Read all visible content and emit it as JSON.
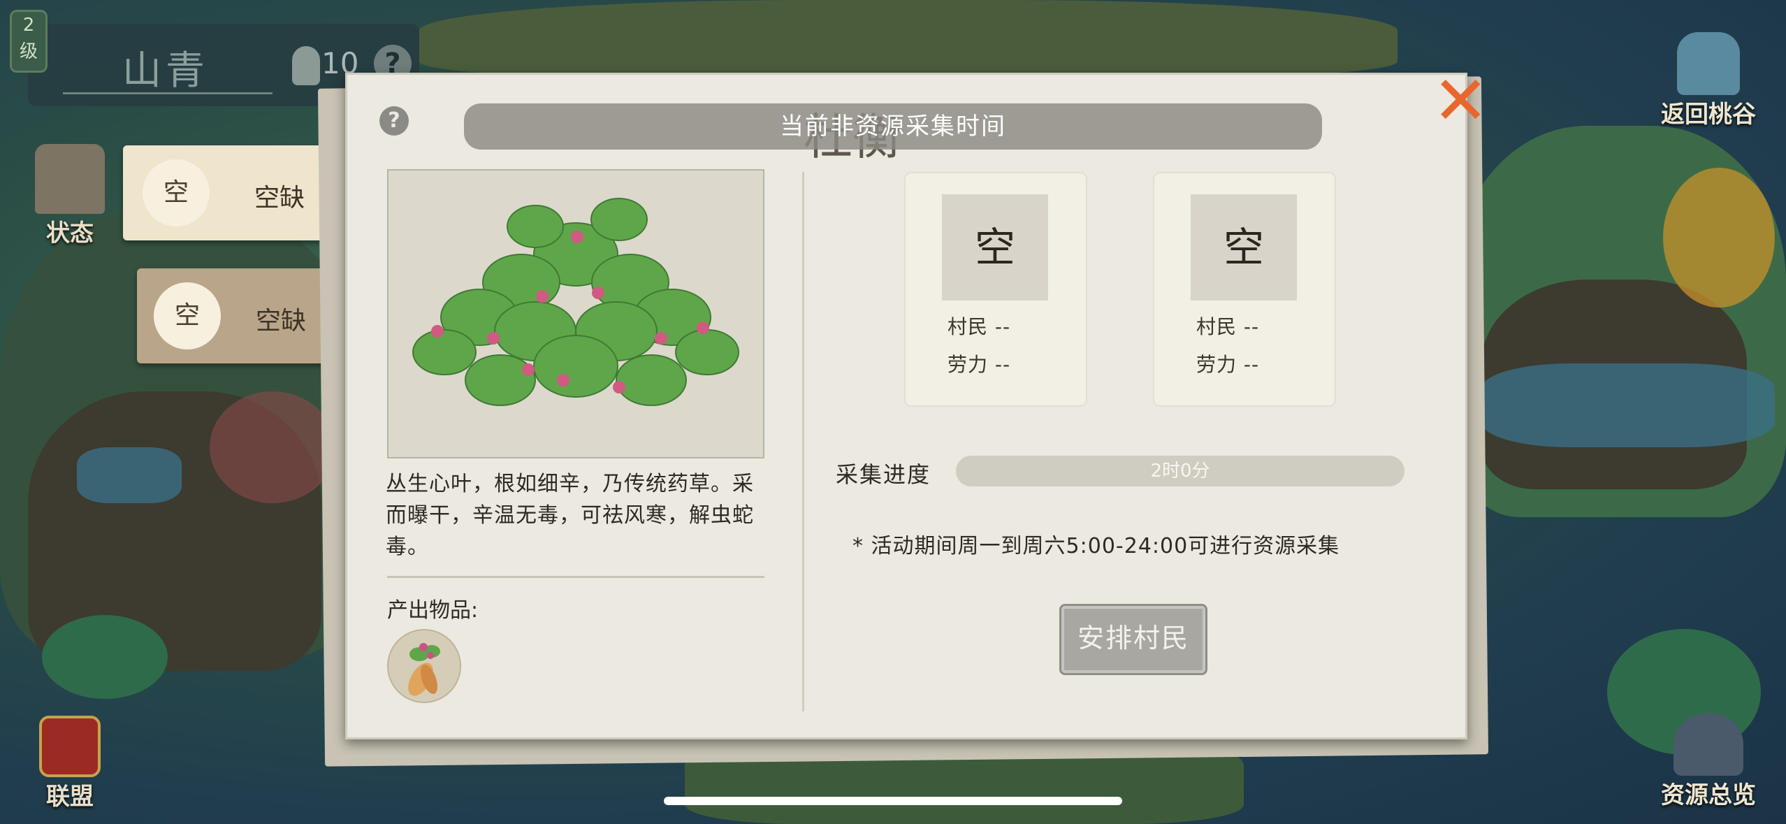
{
  "player": {
    "level": "2\n级",
    "name": "山青",
    "population": "10",
    "help_icon": "?"
  },
  "left_menu": {
    "status_label": "状态",
    "alliance_label": "联盟"
  },
  "slots": [
    {
      "circle": "空",
      "label": "空缺"
    },
    {
      "circle": "空",
      "label": "空缺"
    }
  ],
  "right_menu": {
    "return_label": "返回桃谷",
    "overview_label": "资源总览"
  },
  "dialog": {
    "title": "杜衡",
    "status_banner": "当前非资源采集时间",
    "help_icon": "?",
    "close_icon": "✕",
    "description": "丛生心叶，根如细辛，乃传统药草。采而曝干，辛温无毒，可祛风寒，解虫蛇毒。",
    "output_label": "产出物品:",
    "villagers": [
      {
        "slot": "空",
        "villager_label": "村民 --",
        "labor_label": "劳力 --"
      },
      {
        "slot": "空",
        "villager_label": "村民 --",
        "labor_label": "劳力 --"
      }
    ],
    "progress_label": "采集进度",
    "progress_text": "2时0分",
    "progress_fraction": 0,
    "note": "* 活动期间周一到周六5:00-24:00可进行资源采集",
    "arrange_button": "安排村民"
  },
  "colors": {
    "close": "#e8672e",
    "panel_bg": "#ebe9e0",
    "banner": "#8c8a82"
  }
}
